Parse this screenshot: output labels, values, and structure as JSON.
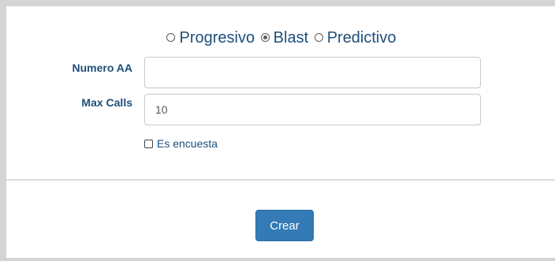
{
  "mode_selector": {
    "options": [
      {
        "label": "Progresivo",
        "checked": false
      },
      {
        "label": "Blast",
        "checked": true
      },
      {
        "label": "Predictivo",
        "checked": false
      }
    ]
  },
  "form": {
    "numero_aa": {
      "label": "Numero AA",
      "value": ""
    },
    "max_calls": {
      "label": "Max Calls",
      "value": "10"
    },
    "es_encuesta": {
      "label": "Es encuesta",
      "checked": false
    }
  },
  "actions": {
    "create_label": "Crear"
  },
  "colors": {
    "label_text": "#1d4f7a",
    "button_bg": "#337ab7",
    "frame_bg": "#d4d4d4"
  }
}
